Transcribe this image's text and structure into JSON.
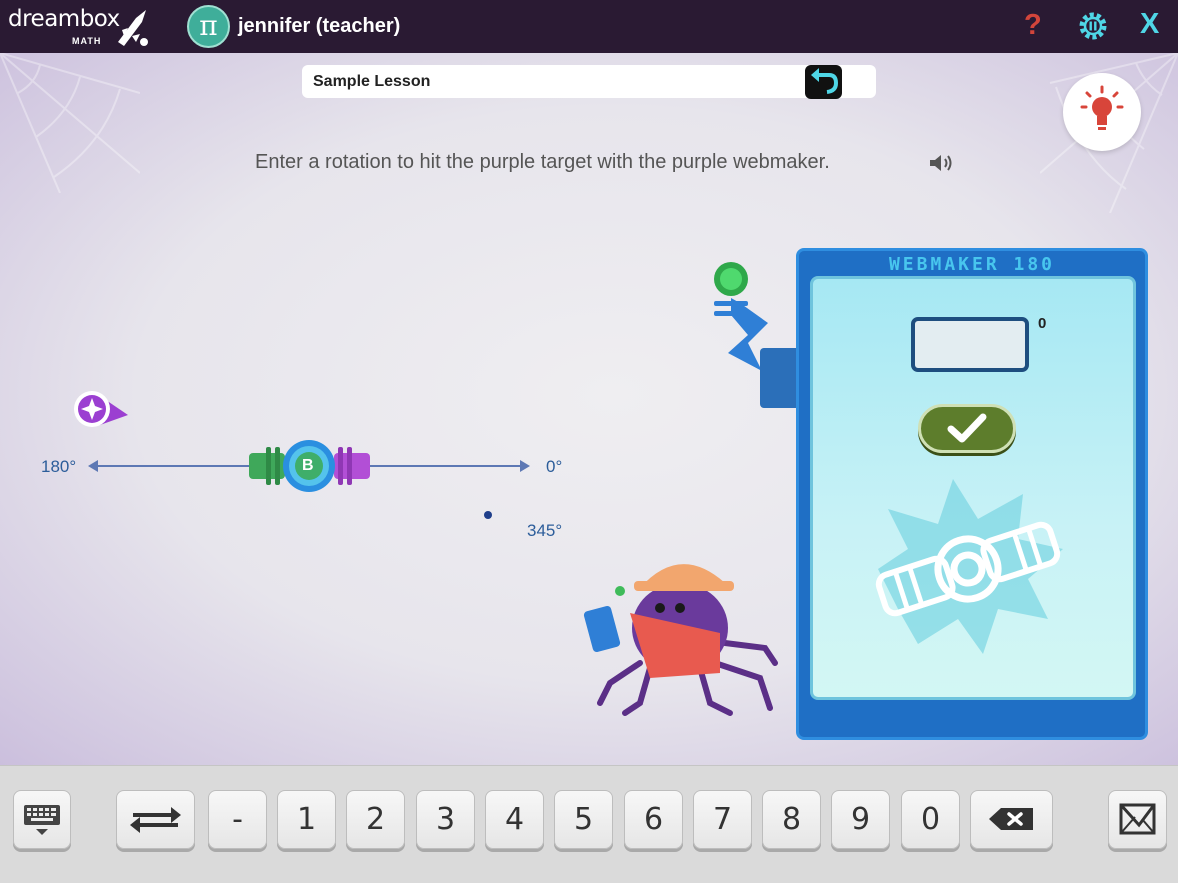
{
  "app": {
    "brand_word": "dreambox",
    "brand_sub": "MATH",
    "user_avatar_symbol": "π",
    "user_name": "jennifer (teacher)",
    "help_symbol": "?",
    "close_symbol": "X"
  },
  "lesson": {
    "title": "Sample Lesson",
    "instruction": "Enter a rotation to hit the purple target with the purple webmaker."
  },
  "diagram": {
    "left_angle": "180°",
    "right_angle": "0°",
    "point_angle": "345°",
    "center_letter": "B"
  },
  "webmaker": {
    "title": "WEBMAKER 180",
    "input_value": "",
    "degree_symbol": "0"
  },
  "keypad": {
    "keys": [
      "-",
      "1",
      "2",
      "3",
      "4",
      "5",
      "6",
      "7",
      "8",
      "9",
      "0"
    ]
  },
  "colors": {
    "topbar": "#2a1a33",
    "accent_cyan": "#4fd6e6",
    "help_red": "#d2453b",
    "machine_blue": "#1f6fc5",
    "submit_green": "#5d7d2c",
    "target_purple": "#9b3fd1"
  }
}
